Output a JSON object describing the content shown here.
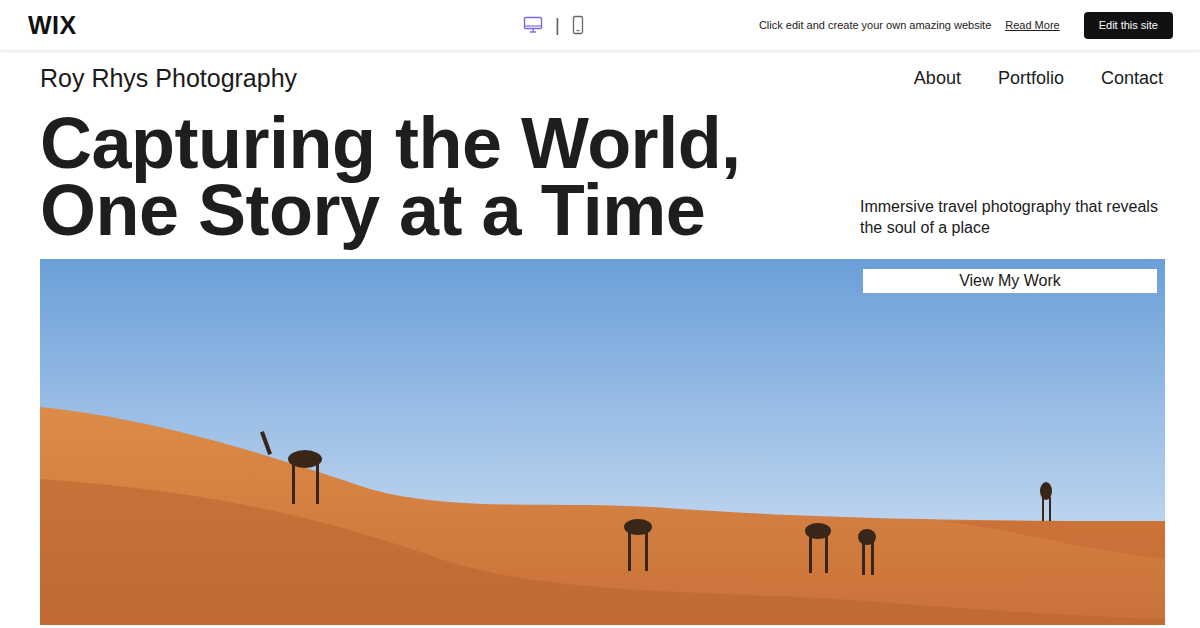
{
  "topbar": {
    "logo": "WIX",
    "devices": [
      {
        "kind": "desktop",
        "selected": true
      },
      {
        "kind": "mobile",
        "selected": false
      }
    ],
    "divider": "|",
    "promo": "Click edit and create your own amazing website",
    "read_more": "Read More",
    "edit_button": "Edit this site"
  },
  "site": {
    "title": "Roy Rhys Photography",
    "nav": [
      "About",
      "Portfolio",
      "Contact"
    ],
    "headline": [
      "Capturing the World,",
      "One Story at a Time"
    ],
    "subtitle": "Immersive travel photography that reveals the soul of a place",
    "cta": "View My Work"
  }
}
